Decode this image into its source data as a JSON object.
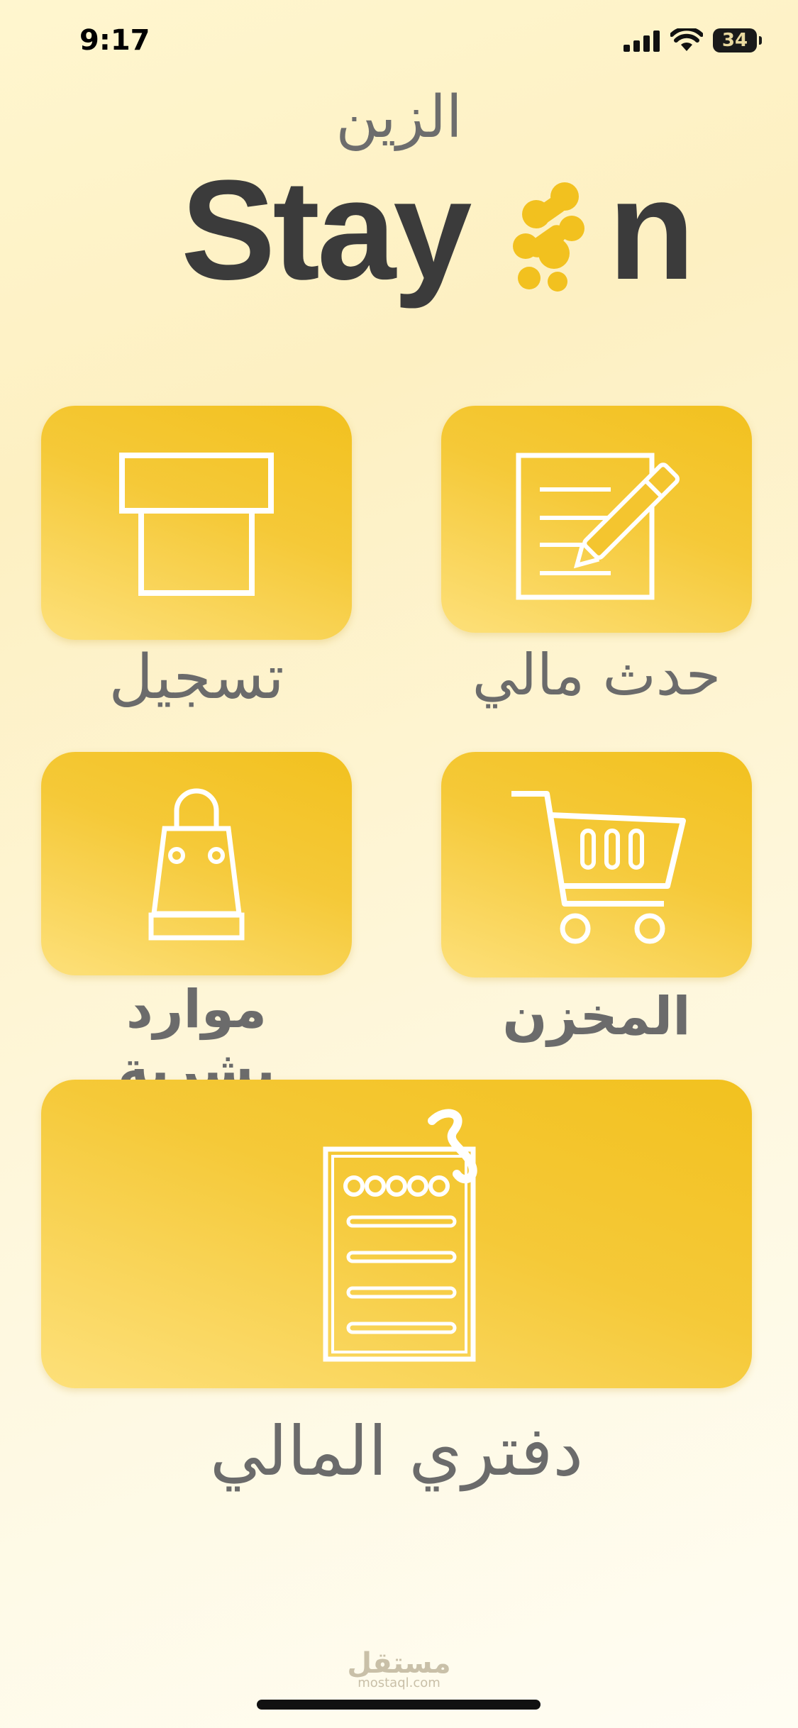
{
  "status_bar": {
    "time": "9:17",
    "battery": "34"
  },
  "brand": {
    "arabic_name": "الزين",
    "logo_left": "Stay",
    "logo_right": "n"
  },
  "tiles": {
    "registration": {
      "label": "تسجيل",
      "icon": "box-icon"
    },
    "financial_event": {
      "label": "حدث مالي",
      "icon": "document-pen-icon"
    },
    "human_resources": {
      "label": "موارد بشرية",
      "icon": "shopping-bag-icon"
    },
    "warehouse": {
      "label": "المخزن",
      "icon": "cart-icon"
    },
    "my_ledger": {
      "label": "دفتري المالي",
      "icon": "ledger-icon"
    }
  },
  "watermark": {
    "arabic": "مستقل",
    "latin": "mostaql.com"
  },
  "colors": {
    "tile": "#f2c11f",
    "label": "#6b6b6b",
    "brand_dark": "#3b3b3b"
  }
}
